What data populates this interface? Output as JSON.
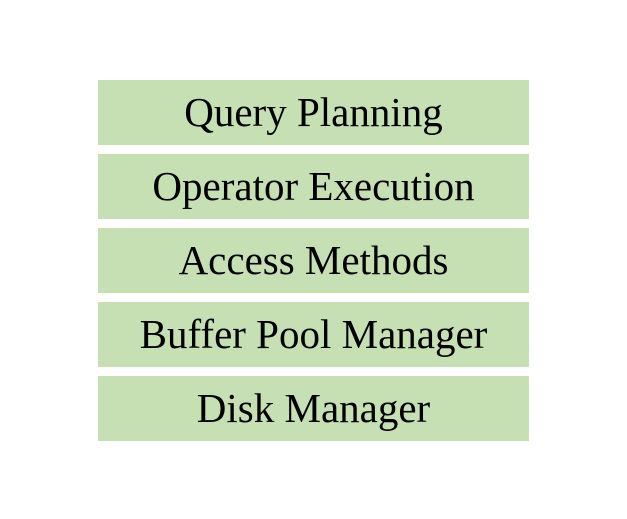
{
  "diagram": {
    "layer_color": "#c6e0b4",
    "layers": [
      {
        "label": "Query Planning"
      },
      {
        "label": "Operator Execution"
      },
      {
        "label": "Access Methods"
      },
      {
        "label": "Buffer Pool Manager"
      },
      {
        "label": "Disk Manager"
      }
    ]
  }
}
